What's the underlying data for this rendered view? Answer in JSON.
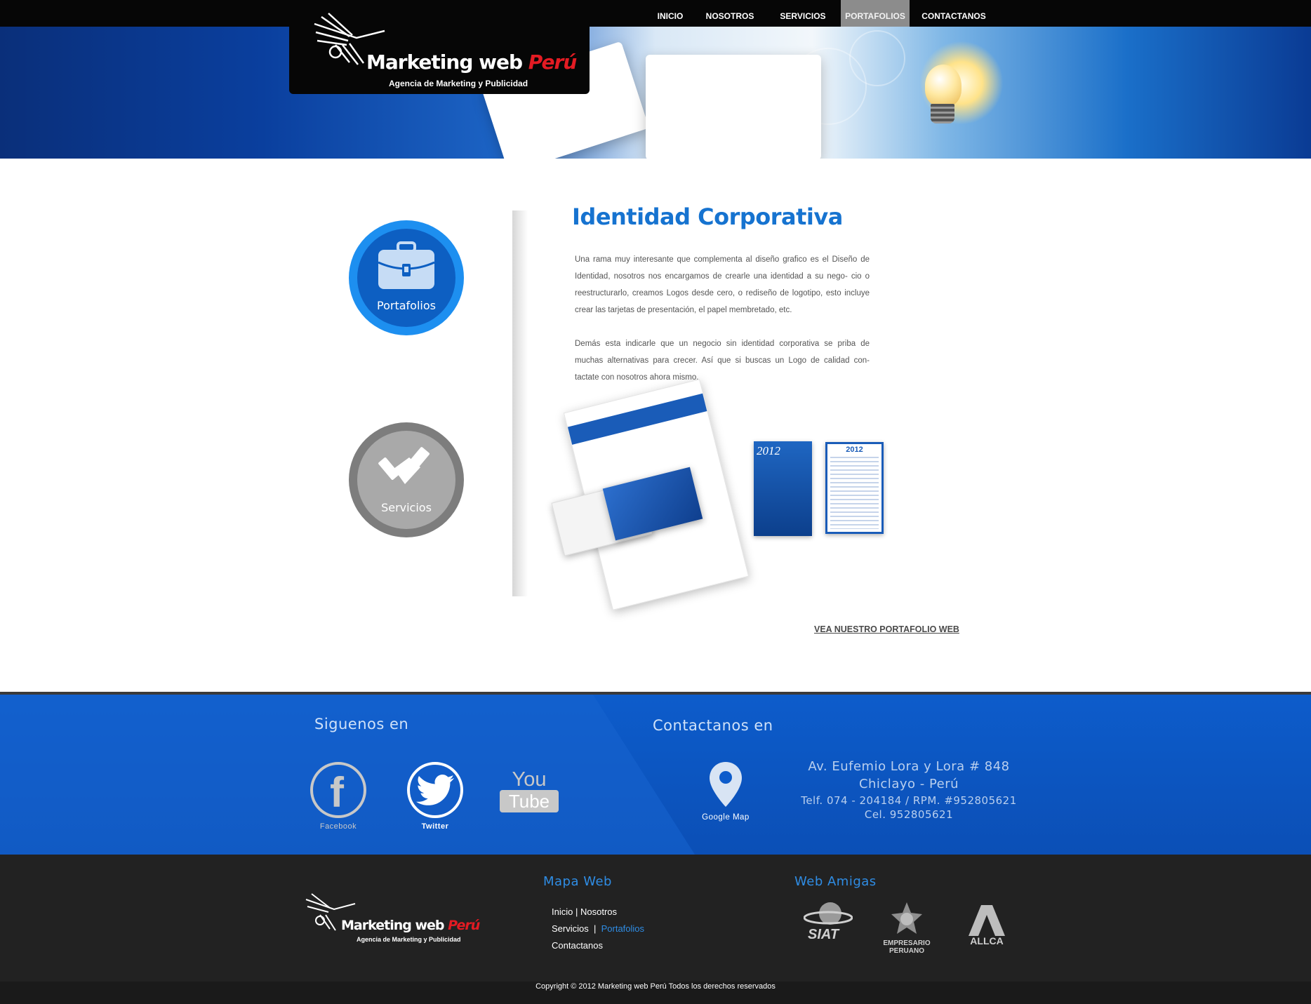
{
  "nav": {
    "items": [
      {
        "label": "INICIO"
      },
      {
        "label": "NOSOTROS"
      },
      {
        "label": "SERVICIOS"
      },
      {
        "label": "PORTAFOLIOS",
        "active": true
      },
      {
        "label": "CONTACTANOS"
      }
    ]
  },
  "logo": {
    "brand_main": "Marketing web ",
    "brand_accent": "Perú",
    "tagline": "Agencia de Marketing y Publicidad"
  },
  "sidebar": {
    "portfolio_label": "Portafolios",
    "services_label": "Servicios"
  },
  "main": {
    "title": "Identidad Corporativa",
    "paragraph1": "Una rama muy interesante que complementa al diseño grafico es el Diseño de Identidad, nosotros nos encargamos de crearle una identidad a su nego- cio o reestructurarlo, creamos Logos desde cero, o rediseño de logotipo, esto incluye crear las tarjetas de presentación, el papel membretado, etc.",
    "paragraph2": "Demás esta indicarle que un negocio sin identidad corporativa se priba de muchas alternativas para crecer. Así que si buscas un Logo de calidad con- tactate con nosotros ahora mismo.",
    "calendar_year": "2012",
    "portfolio_link": "VEA NUESTRO PORTAFOLIO WEB"
  },
  "social": {
    "heading": "Siguenos en",
    "facebook": "Facebook",
    "twitter": "Twitter",
    "youtube_top": "You",
    "youtube_bottom": "Tube"
  },
  "contact": {
    "heading": "Contactanos en",
    "map_label": "Google Map",
    "address_line1": "Av. Eufemio Lora y Lora # 848",
    "address_line2": "Chiclayo - Perú",
    "phone": "Telf. 074 - 204184 / RPM. #952805621",
    "cell": "Cel. 952805621"
  },
  "footer": {
    "sitemap_title": "Mapa Web",
    "sitemap": {
      "inicio": "Inicio",
      "nosotros": "Nosotros",
      "servicios": "Servicios",
      "portafolios": "Portafolios",
      "contactanos": "Contactanos",
      "separator": "|"
    },
    "friends_title": "Web Amigas",
    "friends": {
      "siat": "SIAT",
      "empresario": "EMPRESARIO PERUANO",
      "allca": "ALLCA"
    },
    "copyright": "Copyright © 2012   Marketing web Perú Todos los derechos reservados"
  },
  "colors": {
    "accent_blue": "#1673d0",
    "footer_blue": "#0b4fb6",
    "brand_red": "#e31b23",
    "nav_active": "#8c8c8c"
  },
  "icons": [
    "briefcase-icon",
    "handshake-icon",
    "facebook-icon",
    "twitter-icon",
    "youtube-icon",
    "map-pin-icon"
  ]
}
